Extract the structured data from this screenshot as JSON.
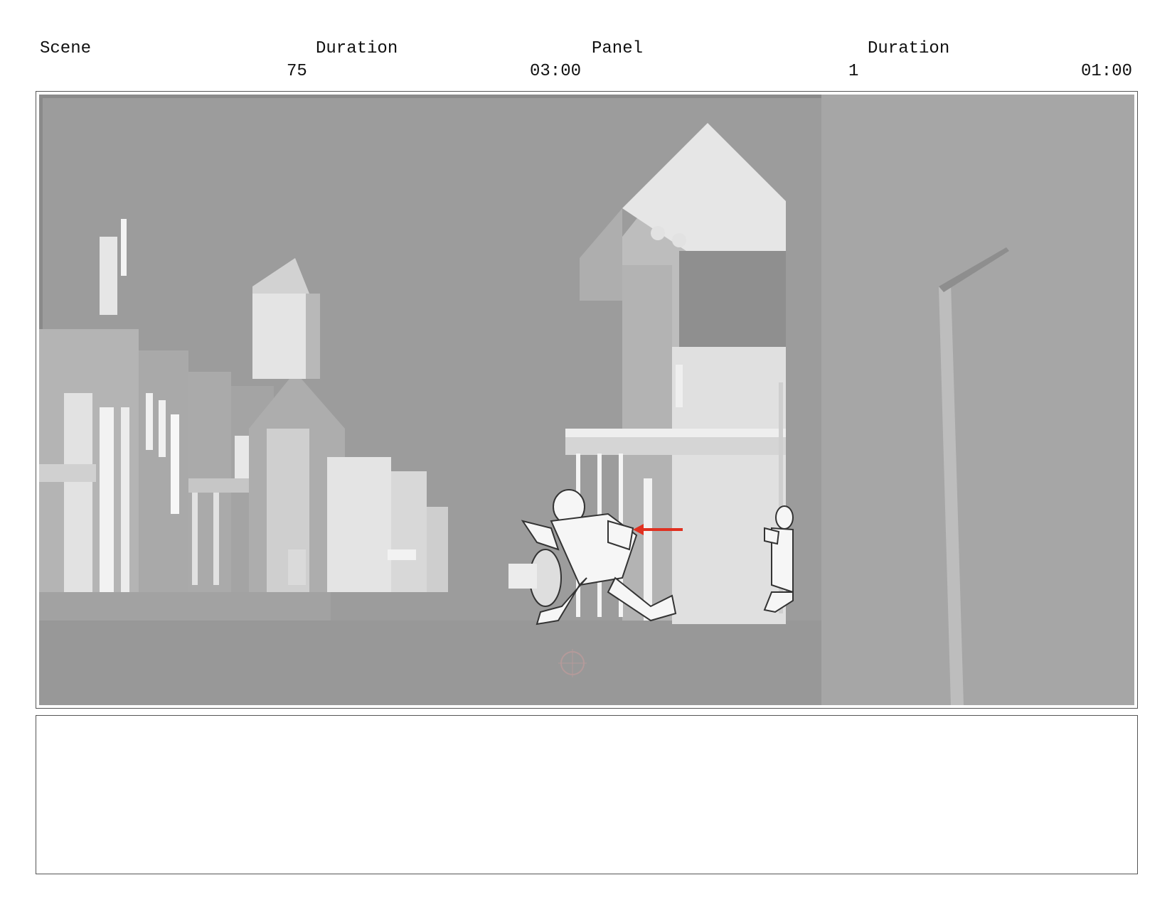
{
  "header": {
    "scene_label": "Scene",
    "scene_duration_label": "Duration",
    "panel_label": "Panel",
    "panel_duration_label": "Duration",
    "scene_value": "75",
    "scene_duration_value": "03:00",
    "panel_value": "1",
    "panel_duration_value": "01:00"
  },
  "notes": {
    "text": ""
  }
}
